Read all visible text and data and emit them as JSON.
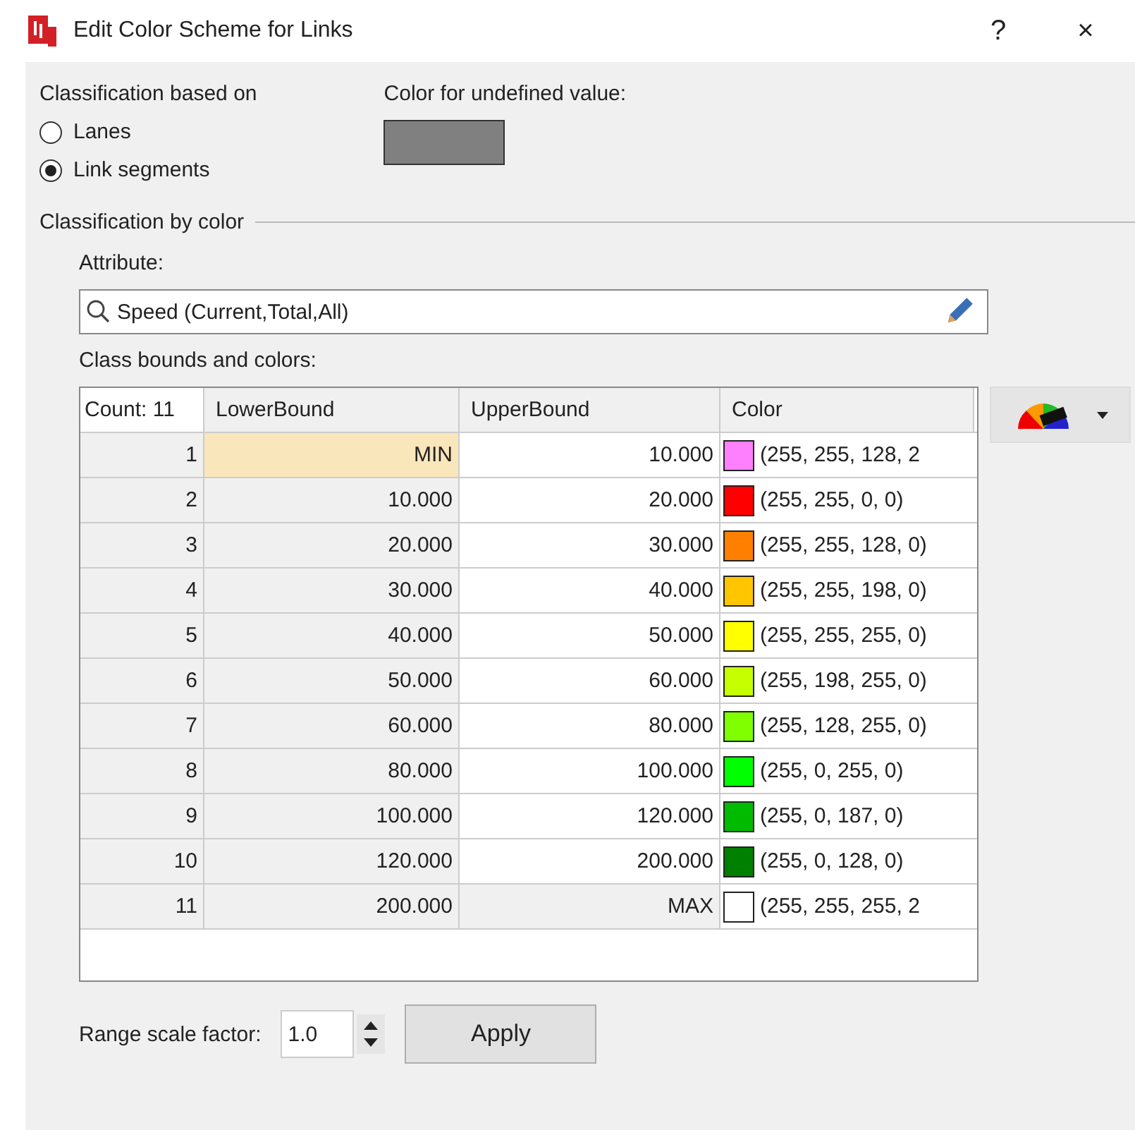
{
  "window": {
    "title": "Edit Color Scheme for Links",
    "help": "?",
    "close": "×"
  },
  "classification_based_on": {
    "label": "Classification based on",
    "options": [
      {
        "label": "Lanes",
        "selected": false
      },
      {
        "label": "Link segments",
        "selected": true
      }
    ]
  },
  "undefined_color": {
    "label": "Color for undefined value:",
    "color": "#808080"
  },
  "classification_by_color": {
    "title": "Classification by color",
    "attribute_label": "Attribute:",
    "attribute_value": "Speed (Current,Total,All)",
    "table_label": "Class bounds and colors:"
  },
  "table": {
    "columns": [
      "Count: 11",
      "LowerBound",
      "UpperBound",
      "Color"
    ],
    "rows": [
      {
        "index": "1",
        "lower": "MIN",
        "upper": "10.000",
        "color": "#ff80ff",
        "color_text": "(255, 255, 128, 2",
        "selected": true,
        "upper_editable": true
      },
      {
        "index": "2",
        "lower": "10.000",
        "upper": "20.000",
        "color": "#ff0000",
        "color_text": "(255, 255, 0, 0)",
        "selected": false,
        "upper_editable": true
      },
      {
        "index": "3",
        "lower": "20.000",
        "upper": "30.000",
        "color": "#ff8000",
        "color_text": "(255, 255, 128, 0)",
        "selected": false,
        "upper_editable": true
      },
      {
        "index": "4",
        "lower": "30.000",
        "upper": "40.000",
        "color": "#ffc600",
        "color_text": "(255, 255, 198, 0)",
        "selected": false,
        "upper_editable": true
      },
      {
        "index": "5",
        "lower": "40.000",
        "upper": "50.000",
        "color": "#ffff00",
        "color_text": "(255, 255, 255, 0)",
        "selected": false,
        "upper_editable": true
      },
      {
        "index": "6",
        "lower": "50.000",
        "upper": "60.000",
        "color": "#c6ff00",
        "color_text": "(255, 198, 255, 0)",
        "selected": false,
        "upper_editable": true
      },
      {
        "index": "7",
        "lower": "60.000",
        "upper": "80.000",
        "color": "#80ff00",
        "color_text": "(255, 128, 255, 0)",
        "selected": false,
        "upper_editable": true
      },
      {
        "index": "8",
        "lower": "80.000",
        "upper": "100.000",
        "color": "#00ff00",
        "color_text": "(255, 0, 255, 0)",
        "selected": false,
        "upper_editable": true
      },
      {
        "index": "9",
        "lower": "100.000",
        "upper": "120.000",
        "color": "#00bb00",
        "color_text": "(255, 0, 187, 0)",
        "selected": false,
        "upper_editable": true
      },
      {
        "index": "10",
        "lower": "120.000",
        "upper": "200.000",
        "color": "#008000",
        "color_text": "(255, 0, 128, 0)",
        "selected": false,
        "upper_editable": true
      },
      {
        "index": "11",
        "lower": "200.000",
        "upper": "MAX",
        "color": "#ffffff",
        "color_text": "(255, 255, 255, 2",
        "selected": false,
        "upper_editable": false
      }
    ]
  },
  "range_scale": {
    "label": "Range scale factor:",
    "value": "1.0"
  },
  "buttons": [
    "Apply"
  ]
}
